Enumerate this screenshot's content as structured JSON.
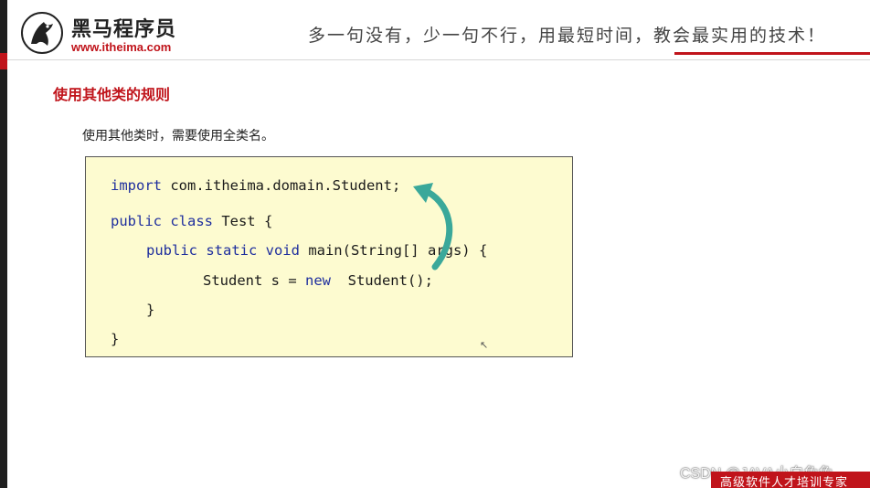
{
  "header": {
    "logo_name": "黑马程序员",
    "logo_url": "www.itheima.com",
    "slogan": "多一句没有，少一句不行，用最短时间，教会最实用的技术！",
    "accent_color": "#c0141b"
  },
  "slide": {
    "title": "使用其他类的规则",
    "description": "使用其他类时，需要使用全类名。"
  },
  "code": {
    "line1_kw": "import",
    "line1_rest": " com.itheima.domain.Student;",
    "line2_kw": "public class",
    "line2_rest": " Test {",
    "line3_kw": "public static void",
    "line3_rest": " main(String[] args) {",
    "line4_pre": "Student s = ",
    "line4_kw": "new",
    "line4_post": "  Student();",
    "line5": "}",
    "line6": "}"
  },
  "footer": {
    "band_text": "高级软件人才培训专家",
    "watermark": "CSDN @JAVA小白兔兔"
  },
  "icons": {
    "logo": "horse-logo-icon",
    "arrow": "curved-arrow-icon",
    "cursor": "mouse-cursor-icon"
  }
}
